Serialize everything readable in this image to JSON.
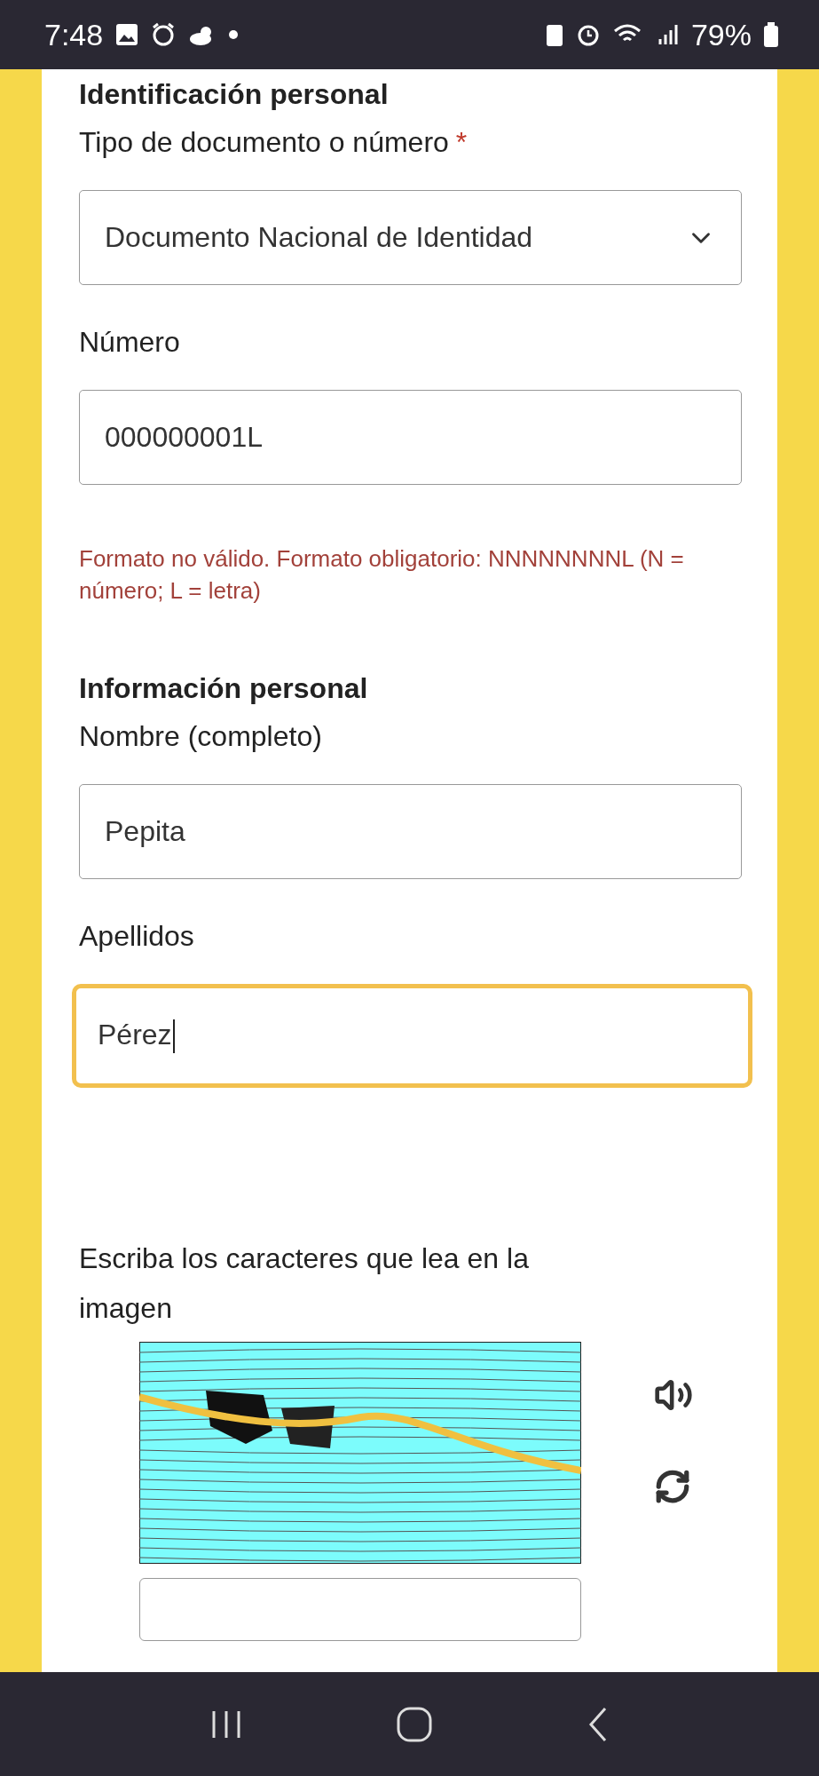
{
  "status_bar": {
    "time": "7:48",
    "battery": "79%"
  },
  "sections": [
    {
      "title": "Identificación personal",
      "fields": [
        {
          "kind": "select",
          "label": "Tipo de documento o número",
          "required": true,
          "required_mark": "*",
          "value": "Documento Nacional de Identidad",
          "focused": false
        },
        {
          "kind": "text",
          "label": "Número",
          "value": "000000001L",
          "focused": false,
          "error": "Formato no válido. Formato obligatorio: NNNNNNNNL (N = número; L = letra)"
        }
      ]
    },
    {
      "title": "Información personal",
      "fields": [
        {
          "kind": "text",
          "label": "Nombre (completo)",
          "value": "Pepita",
          "focused": false
        },
        {
          "kind": "text",
          "label": "Apellidos",
          "value": "Pérez",
          "focused": true
        }
      ]
    }
  ],
  "captcha": {
    "label": "Escriba los caracteres que lea en la imagen"
  }
}
